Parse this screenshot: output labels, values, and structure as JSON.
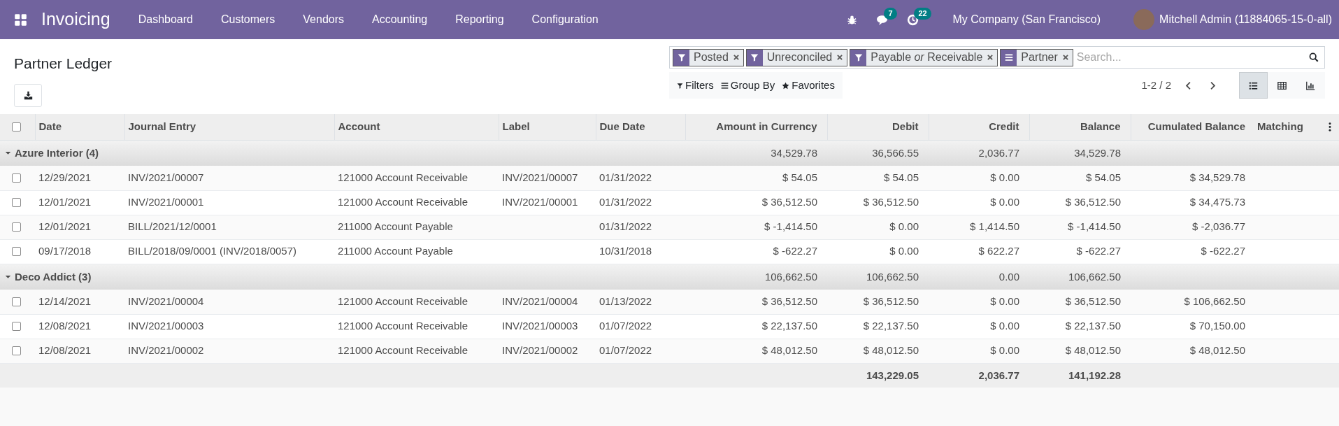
{
  "navbar": {
    "app_name": "Invoicing",
    "menu": [
      "Dashboard",
      "Customers",
      "Vendors",
      "Accounting",
      "Reporting",
      "Configuration"
    ],
    "messages_count": "7",
    "activities_count": "22",
    "company": "My Company (San Francisco)",
    "user": "Mitchell Admin (11884065-15-0-all)"
  },
  "control_panel": {
    "title": "Partner Ledger",
    "facets": [
      {
        "kind": "filter",
        "label": "Posted"
      },
      {
        "kind": "filter",
        "label": "Unreconciled"
      },
      {
        "kind": "filter",
        "label": "Payable *or* Receivable"
      },
      {
        "kind": "group",
        "label": "Partner"
      }
    ],
    "search": {
      "placeholder": "Search..."
    },
    "dropdowns": [
      {
        "kind": "filter",
        "label": "Filters"
      },
      {
        "kind": "group",
        "label": "Group By"
      },
      {
        "kind": "favorite",
        "label": "Favorites"
      }
    ],
    "pager": "1-2 / 2",
    "views": [
      {
        "kind": "list",
        "selected": true
      },
      {
        "kind": "pivot",
        "selected": false
      },
      {
        "kind": "graph",
        "selected": false
      }
    ]
  },
  "table": {
    "select_all": false,
    "columns": [
      "Date",
      "Journal Entry",
      "Account",
      "Label",
      "Due Date",
      "Amount in Currency",
      "Debit",
      "Credit",
      "Balance",
      "Cumulated Balance",
      "Matching"
    ],
    "groups": [
      {
        "name": "Azure Interior (4)",
        "expanded": true,
        "amount": "34,529.78",
        "debit": "36,566.55",
        "credit": "2,036.77",
        "balance": "34,529.78",
        "rows": [
          {
            "checked": false,
            "cells": [
              "12/29/2021",
              "INV/2021/00007",
              "121000 Account Receivable",
              "INV/2021/00007",
              "01/31/2022",
              "$ 54.05",
              "$ 54.05",
              "$ 0.00",
              "$ 54.05",
              "$ 34,529.78"
            ]
          },
          {
            "checked": false,
            "cells": [
              "12/01/2021",
              "INV/2021/00001",
              "121000 Account Receivable",
              "INV/2021/00001",
              "01/31/2022",
              "$ 36,512.50",
              "$ 36,512.50",
              "$ 0.00",
              "$ 36,512.50",
              "$ 34,475.73"
            ]
          },
          {
            "checked": false,
            "cells": [
              "12/01/2021",
              "BILL/2021/12/0001",
              "211000 Account Payable",
              "",
              "01/31/2022",
              "$ -1,414.50",
              "$ 0.00",
              "$ 1,414.50",
              "$ -1,414.50",
              "$ -2,036.77"
            ]
          },
          {
            "checked": false,
            "cells": [
              "09/17/2018",
              "BILL/2018/09/0001 (INV/2018/0057)",
              "211000 Account Payable",
              "",
              "10/31/2018",
              "$ -622.27",
              "$ 0.00",
              "$ 622.27",
              "$ -622.27",
              "$ -622.27"
            ]
          }
        ]
      },
      {
        "name": "Deco Addict (3)",
        "expanded": true,
        "amount": "106,662.50",
        "debit": "106,662.50",
        "credit": "0.00",
        "balance": "106,662.50",
        "rows": [
          {
            "checked": false,
            "cells": [
              "12/14/2021",
              "INV/2021/00004",
              "121000 Account Receivable",
              "INV/2021/00004",
              "01/13/2022",
              "$ 36,512.50",
              "$ 36,512.50",
              "$ 0.00",
              "$ 36,512.50",
              "$ 106,662.50"
            ]
          },
          {
            "checked": false,
            "cells": [
              "12/08/2021",
              "INV/2021/00003",
              "121000 Account Receivable",
              "INV/2021/00003",
              "01/07/2022",
              "$ 22,137.50",
              "$ 22,137.50",
              "$ 0.00",
              "$ 22,137.50",
              "$ 70,150.00"
            ]
          },
          {
            "checked": false,
            "cells": [
              "12/08/2021",
              "INV/2021/00002",
              "121000 Account Receivable",
              "INV/2021/00002",
              "01/07/2022",
              "$ 48,012.50",
              "$ 48,012.50",
              "$ 0.00",
              "$ 48,012.50",
              "$ 48,012.50"
            ]
          }
        ]
      }
    ],
    "totals": {
      "debit": "143,229.05",
      "credit": "2,036.77",
      "balance": "141,192.28"
    }
  }
}
